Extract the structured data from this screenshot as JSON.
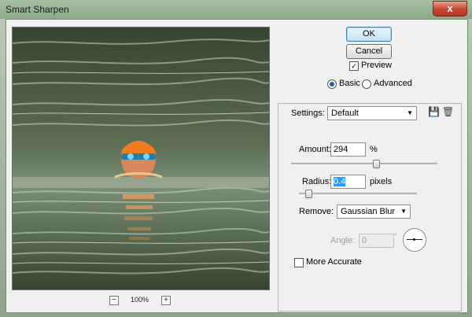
{
  "window": {
    "title": "Smart Sharpen",
    "close_glyph": "x"
  },
  "preview": {
    "zoom_out": "−",
    "zoom_in": "+",
    "zoom_level": "100%"
  },
  "buttons": {
    "ok": "OK",
    "cancel": "Cancel"
  },
  "options": {
    "preview_label": "Preview",
    "preview_checked": true,
    "mode_basic": "Basic",
    "mode_advanced": "Advanced",
    "selected_mode": "Basic"
  },
  "settings": {
    "label": "Settings:",
    "value": "Default",
    "save_icon": "save-settings-icon",
    "delete_icon": "trash-icon"
  },
  "amount": {
    "label": "Amount:",
    "value": "294",
    "unit": "%",
    "slider_fraction": 0.59
  },
  "radius": {
    "label": "Radius:",
    "value": "0.4",
    "unit": "pixels",
    "slider_fraction": 0.06
  },
  "remove": {
    "label": "Remove:",
    "value": "Gaussian Blur"
  },
  "angle": {
    "label": "Angle:",
    "value": "0",
    "unit": "°"
  },
  "more_accurate": {
    "label": "More Accurate",
    "checked": false
  },
  "colors": {
    "accent": "#3399ff",
    "default_button": "#3c7fb1"
  }
}
